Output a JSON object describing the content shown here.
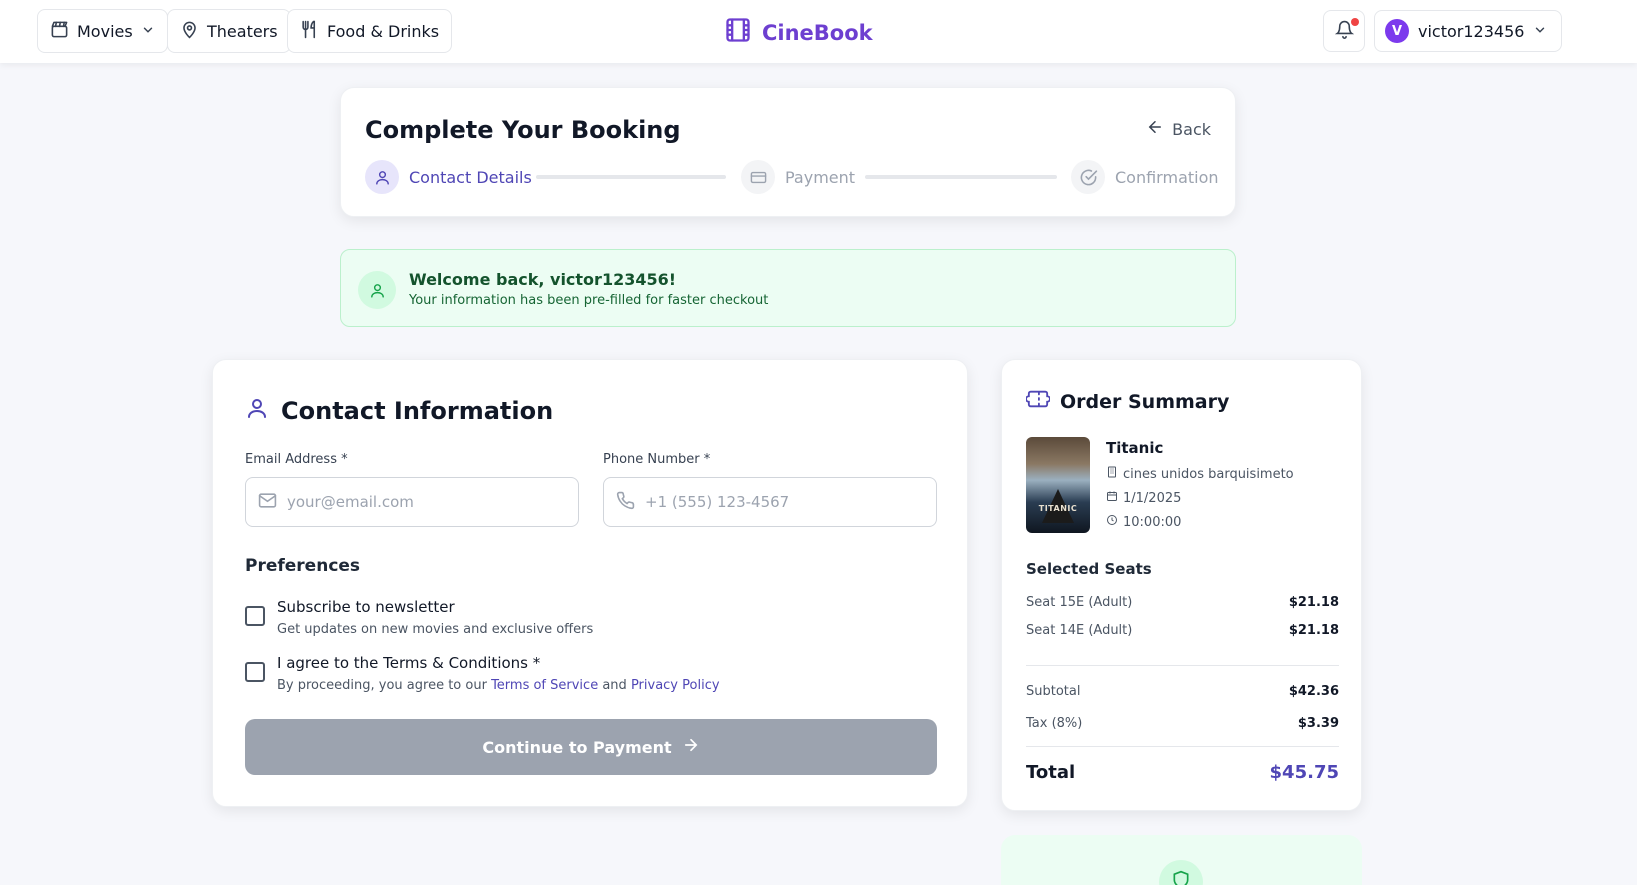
{
  "nav": {
    "movies_label": "Movies",
    "theaters_label": "Theaters",
    "food_label": "Food & Drinks",
    "brand": "CineBook",
    "user_initial": "V",
    "username": "victor123456"
  },
  "booking": {
    "title": "Complete Your Booking",
    "back_label": "Back",
    "steps": [
      {
        "label": "Contact Details",
        "active": true
      },
      {
        "label": "Payment",
        "active": false
      },
      {
        "label": "Confirmation",
        "active": false
      }
    ]
  },
  "welcome": {
    "title": "Welcome back, victor123456!",
    "subtitle": "Your information has been pre-filled for faster checkout"
  },
  "contact": {
    "title": "Contact Information",
    "email_label": "Email Address *",
    "email_placeholder": "your@email.com",
    "email_value": "",
    "phone_label": "Phone Number *",
    "phone_placeholder": "+1 (555) 123-4567",
    "phone_value": "",
    "preferences_title": "Preferences",
    "newsletter_label": "Subscribe to newsletter",
    "newsletter_sub": "Get updates on new movies and exclusive offers",
    "newsletter_checked": false,
    "terms_label": "I agree to the Terms & Conditions *",
    "terms_sub_prefix": "By proceeding, you agree to our",
    "terms_link": "Terms of Service",
    "terms_and": "and",
    "privacy_link": "Privacy Policy",
    "terms_checked": false,
    "continue_label": "Continue to Payment"
  },
  "summary": {
    "title": "Order Summary",
    "movie_title": "Titanic",
    "poster_text": "TITANIC",
    "theater": "cines unidos barquisimeto",
    "date": "1/1/2025",
    "time": "10:00:00",
    "seats_title": "Selected Seats",
    "seats": [
      {
        "label": "Seat 15E (Adult)",
        "price": "$21.18"
      },
      {
        "label": "Seat 14E (Adult)",
        "price": "$21.18"
      }
    ],
    "subtotal_label": "Subtotal",
    "subtotal": "$42.36",
    "tax_label": "Tax (8%)",
    "tax": "$3.39",
    "total_label": "Total",
    "total": "$45.75"
  },
  "colors": {
    "accent": "#4f46b5",
    "brand": "#6d3fd0",
    "success_bg": "#ecfdf3",
    "disabled_button": "#9ca3af"
  }
}
